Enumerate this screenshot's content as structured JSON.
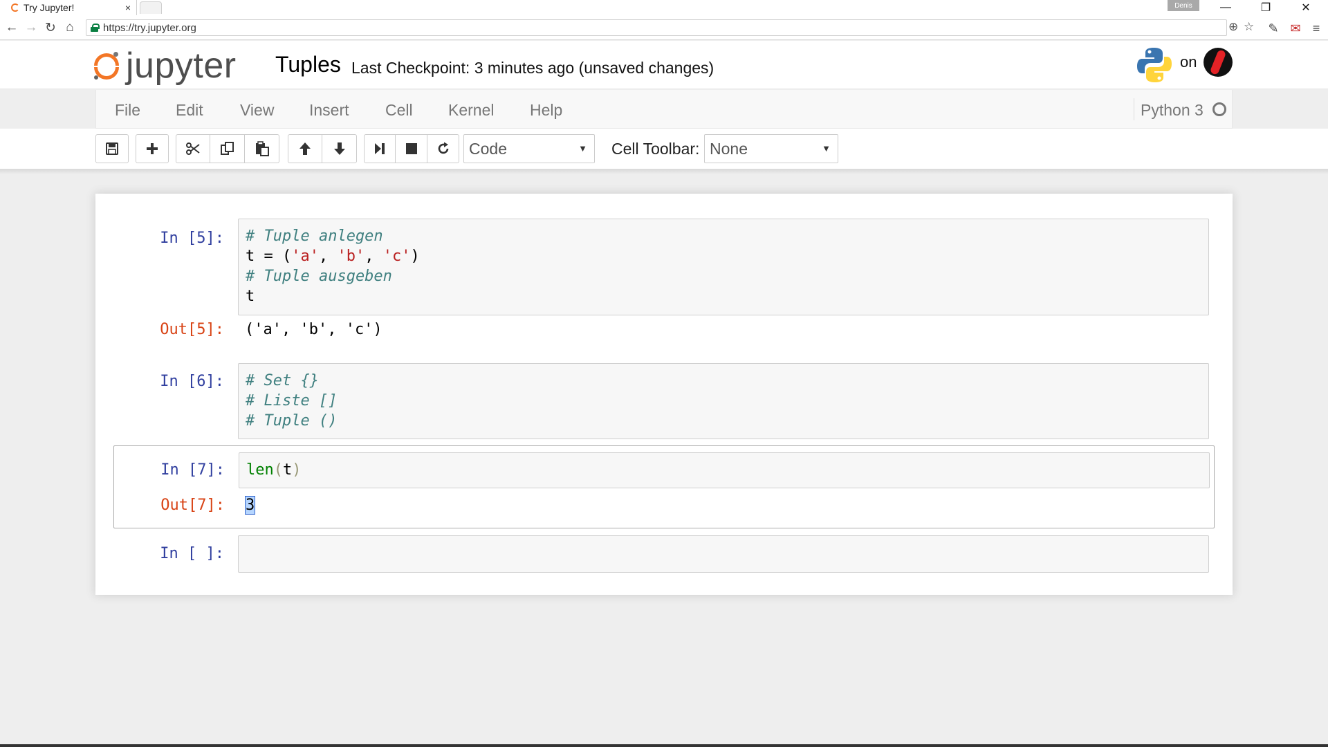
{
  "browser": {
    "tab_title": "Try Jupyter!",
    "tab_close": "×",
    "profile": "Denis",
    "url": "https://try.jupyter.org",
    "window_controls": {
      "minimize": "—",
      "restore": "❐",
      "close": "✕"
    }
  },
  "header": {
    "logo_text": "jupyter",
    "notebook_name": "Tuples",
    "checkpoint": "Last Checkpoint: 3 minutes ago (unsaved changes)",
    "on_label": "on"
  },
  "menu": {
    "items": [
      "File",
      "Edit",
      "View",
      "Insert",
      "Cell",
      "Kernel",
      "Help"
    ],
    "kernel_name": "Python 3"
  },
  "toolbar": {
    "icons": [
      "save-icon",
      "plus-icon",
      "scissors-icon",
      "copy-icon",
      "paste-icon",
      "arrow-up-icon",
      "arrow-down-icon",
      "run-next-icon",
      "stop-icon",
      "restart-icon"
    ],
    "cell_type": "Code",
    "cell_toolbar_label": "Cell Toolbar:",
    "cell_toolbar_value": "None"
  },
  "cells": {
    "c5": {
      "in_prompt": "In [5]:",
      "line1": "# Tuple anlegen",
      "line2_a": "t = (",
      "line2_s1": "'a'",
      "line2_c1": ", ",
      "line2_s2": "'b'",
      "line2_c2": ", ",
      "line2_s3": "'c'",
      "line2_b": ")",
      "line3": "# Tuple ausgeben",
      "line4": "t",
      "out_prompt": "Out[5]:",
      "output": "('a', 'b', 'c')"
    },
    "c6": {
      "in_prompt": "In [6]:",
      "line1": "# Set {}",
      "line2": "# Liste []",
      "line3": "# Tuple ()"
    },
    "c7": {
      "in_prompt": "In [7]:",
      "code_fn": "len",
      "code_open": "(",
      "code_arg": "t",
      "code_close": ")",
      "out_prompt": "Out[7]:",
      "output": "3"
    },
    "c8": {
      "in_prompt": "In [ ]:",
      "code": ""
    }
  },
  "colors": {
    "accent": "#f37626",
    "in_prompt": "#303f9f",
    "out_prompt": "#d84315"
  }
}
